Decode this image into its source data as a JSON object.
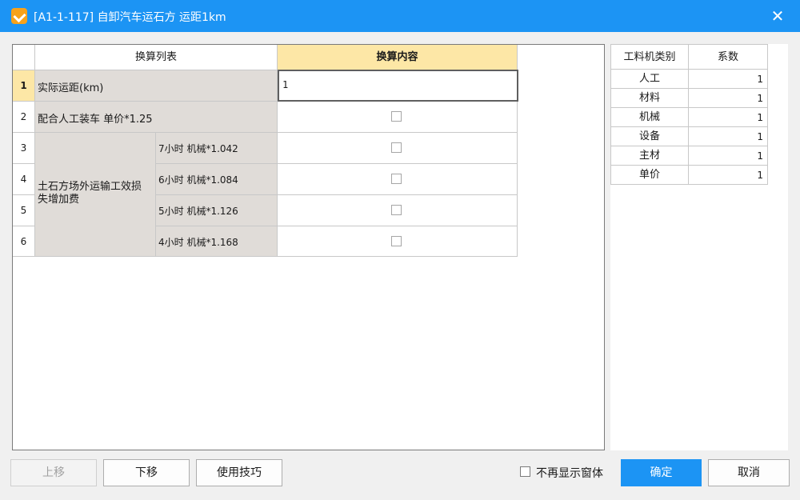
{
  "window": {
    "title": "[A1-1-117] 自卸汽车运石方 运距1km",
    "close_symbol": "✕"
  },
  "grid": {
    "headers": {
      "list": "换算列表",
      "content": "换算内容"
    },
    "rows": [
      {
        "num": "1",
        "label": "实际运距(km)",
        "value": "1"
      },
      {
        "num": "2",
        "label": "配合人工装车 单价*1.25"
      },
      {
        "num": "3",
        "sub": "7小时 机械*1.042"
      },
      {
        "num": "4",
        "sub": "6小时 机械*1.084"
      },
      {
        "num": "5",
        "sub": "5小时 机械*1.126"
      },
      {
        "num": "6",
        "sub": "4小时 机械*1.168"
      }
    ],
    "group_label": "土石方场外运输工效损失增加费"
  },
  "coefficients": {
    "headers": {
      "category": "工料机类别",
      "factor": "系数"
    },
    "rows": [
      {
        "category": "人工",
        "factor": "1"
      },
      {
        "category": "材料",
        "factor": "1"
      },
      {
        "category": "机械",
        "factor": "1"
      },
      {
        "category": "设备",
        "factor": "1"
      },
      {
        "category": "主材",
        "factor": "1"
      },
      {
        "category": "单价",
        "factor": "1"
      }
    ]
  },
  "footer": {
    "move_up": "上移",
    "move_down": "下移",
    "tips": "使用技巧",
    "dont_show": "不再显示窗体",
    "ok": "确定",
    "cancel": "取消"
  },
  "colors": {
    "accent": "#1c94f4",
    "header_highlight": "#fde7a6",
    "gray_cell": "#e0dcd8"
  }
}
